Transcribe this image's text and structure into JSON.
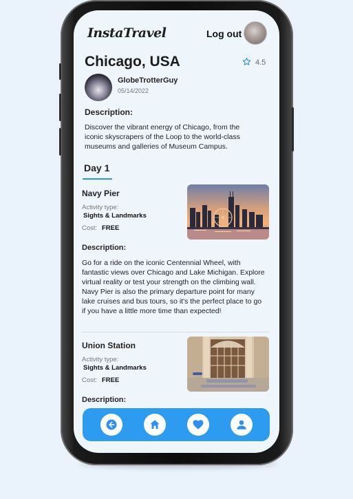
{
  "app": {
    "logo": "InstaTravel"
  },
  "header": {
    "logout_label": "Log out"
  },
  "place": {
    "title": "Chicago, USA",
    "rating": "4.5"
  },
  "author": {
    "name": "GlobeTrotterGuy",
    "date": "05/14/2022"
  },
  "description": {
    "label": "Description:",
    "text": "Discover the vibrant energy of Chicago, from the iconic skyscrapers of the Loop to the world-class museums and galleries of Museum Campus."
  },
  "day": {
    "label": "Day 1"
  },
  "activities": [
    {
      "name": "Navy Pier",
      "type_label": "Activity type:",
      "type": "Sights & Landmarks",
      "cost_label": "Cost:",
      "cost": "FREE",
      "desc_label": "Description:",
      "desc": "Go for a ride on the iconic Centennial Wheel, with fantastic views over Chicago and Lake Michigan. Explore virtual reality or test your strength on the climbing wall. Navy Pier is also the primary departure point for many lake cruises and bus tours, so it's the perfect place to go if you have a little more time than expected!"
    },
    {
      "name": "Union Station",
      "type_label": "Activity type:",
      "type": "Sights & Landmarks",
      "cost_label": "Cost:",
      "cost": "FREE",
      "desc_label": "Description:"
    }
  ],
  "nav": {
    "items": [
      {
        "icon": "back-arrow-icon"
      },
      {
        "icon": "home-icon"
      },
      {
        "icon": "heart-icon"
      },
      {
        "icon": "profile-icon"
      }
    ]
  },
  "colors": {
    "accent": "#2f8ff0",
    "nav_bg": "#2d9bf0",
    "screen_bg": "#eef6fc",
    "page_bg": "#eaf3fb"
  }
}
